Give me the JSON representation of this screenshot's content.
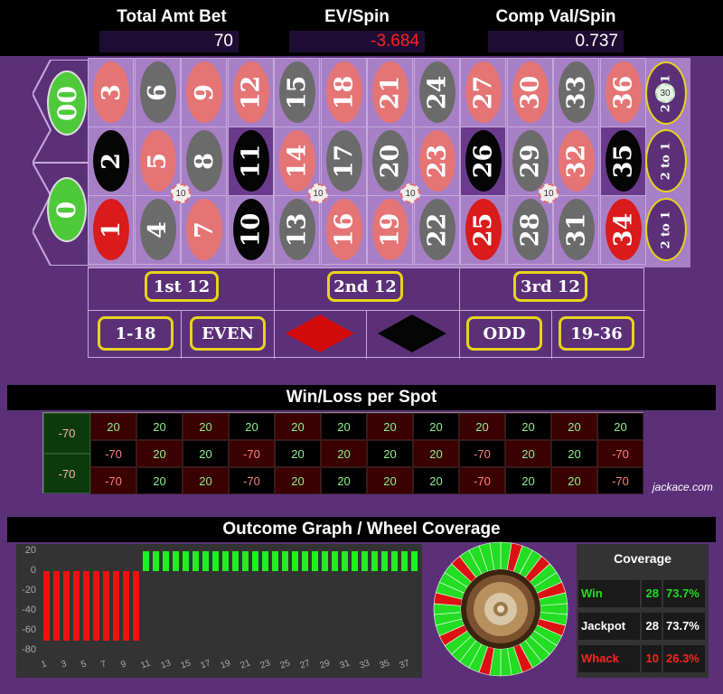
{
  "stats": {
    "total_label": "Total Amt Bet",
    "total_value": "70",
    "ev_label": "EV/Spin",
    "ev_value": "-3.684",
    "comp_label": "Comp Val/Spin",
    "comp_value": "0.737"
  },
  "board": {
    "double_zero": "00",
    "zero": "0",
    "rows": [
      [
        {
          "n": "3",
          "c": "pink"
        },
        {
          "n": "6",
          "c": "gray"
        },
        {
          "n": "9",
          "c": "pink"
        },
        {
          "n": "12",
          "c": "pink"
        },
        {
          "n": "15",
          "c": "gray"
        },
        {
          "n": "18",
          "c": "pink"
        },
        {
          "n": "21",
          "c": "pink"
        },
        {
          "n": "24",
          "c": "gray"
        },
        {
          "n": "27",
          "c": "pink"
        },
        {
          "n": "30",
          "c": "pink"
        },
        {
          "n": "33",
          "c": "gray"
        },
        {
          "n": "36",
          "c": "pink"
        }
      ],
      [
        {
          "n": "2",
          "c": "black"
        },
        {
          "n": "5",
          "c": "pink"
        },
        {
          "n": "8",
          "c": "gray"
        },
        {
          "n": "11",
          "c": "black"
        },
        {
          "n": "14",
          "c": "pink"
        },
        {
          "n": "17",
          "c": "gray"
        },
        {
          "n": "20",
          "c": "gray"
        },
        {
          "n": "23",
          "c": "pink"
        },
        {
          "n": "26",
          "c": "black"
        },
        {
          "n": "29",
          "c": "gray"
        },
        {
          "n": "32",
          "c": "pink"
        },
        {
          "n": "35",
          "c": "black"
        }
      ],
      [
        {
          "n": "1",
          "c": "red"
        },
        {
          "n": "4",
          "c": "gray"
        },
        {
          "n": "7",
          "c": "pink"
        },
        {
          "n": "10",
          "c": "black"
        },
        {
          "n": "13",
          "c": "gray"
        },
        {
          "n": "16",
          "c": "pink"
        },
        {
          "n": "19",
          "c": "pink"
        },
        {
          "n": "22",
          "c": "gray"
        },
        {
          "n": "25",
          "c": "red"
        },
        {
          "n": "28",
          "c": "gray"
        },
        {
          "n": "31",
          "c": "gray"
        },
        {
          "n": "34",
          "c": "red"
        }
      ]
    ],
    "columns": [
      "2 to 1",
      "2 to 1",
      "2 to 1"
    ],
    "dozens": [
      "1st 12",
      "2nd 12",
      "3rd 12"
    ],
    "outside": [
      "1-18",
      "EVEN",
      "ODD",
      "19-36"
    ],
    "chips": [
      "30",
      "10",
      "10",
      "10",
      "10"
    ]
  },
  "winloss": {
    "title": "Win/Loss per Spot",
    "zero_values": [
      "-70",
      "-70"
    ],
    "rows": [
      [
        "20",
        "20",
        "20",
        "20",
        "20",
        "20",
        "20",
        "20",
        "20",
        "20",
        "20",
        "20"
      ],
      [
        "-70",
        "20",
        "20",
        "-70",
        "20",
        "20",
        "20",
        "20",
        "-70",
        "20",
        "20",
        "-70"
      ],
      [
        "-70",
        "20",
        "20",
        "-70",
        "20",
        "20",
        "20",
        "20",
        "-70",
        "20",
        "20",
        "-70"
      ]
    ],
    "credit": "jackace.com"
  },
  "outcome": {
    "title": "Outcome Graph / Wheel Coverage",
    "y_ticks": [
      "20",
      "0",
      "-20",
      "-40",
      "-60",
      "-80"
    ],
    "x_ticks": [
      "1",
      "3",
      "5",
      "7",
      "9",
      "11",
      "13",
      "15",
      "17",
      "19",
      "21",
      "23",
      "25",
      "27",
      "29",
      "31",
      "33",
      "35",
      "37"
    ]
  },
  "chart_data": {
    "type": "bar",
    "title": "",
    "x": [
      1,
      2,
      3,
      4,
      5,
      6,
      7,
      8,
      9,
      10,
      11,
      12,
      13,
      14,
      15,
      16,
      17,
      18,
      19,
      20,
      21,
      22,
      23,
      24,
      25,
      26,
      27,
      28,
      29,
      30,
      31,
      32,
      33,
      34,
      35,
      36,
      37,
      38
    ],
    "values": [
      -70,
      -70,
      -70,
      -70,
      -70,
      -70,
      -70,
      -70,
      -70,
      -70,
      20,
      20,
      20,
      20,
      20,
      20,
      20,
      20,
      20,
      20,
      20,
      20,
      20,
      20,
      20,
      20,
      20,
      20,
      20,
      20,
      20,
      20,
      20,
      20,
      20,
      20,
      20,
      20
    ],
    "ylim": [
      -80,
      20
    ],
    "colors": {
      "win": "#22ee22",
      "loss": "#ee1111"
    }
  },
  "wheel": {
    "segments": [
      "W",
      "L",
      "W",
      "W",
      "L",
      "W",
      "W",
      "L",
      "W",
      "W",
      "W",
      "L",
      "W",
      "W",
      "W",
      "W",
      "L",
      "W",
      "W",
      "W",
      "L",
      "W",
      "W",
      "W",
      "W",
      "L",
      "W",
      "W",
      "W",
      "L",
      "W",
      "W",
      "W",
      "L",
      "W",
      "W",
      "W",
      "W"
    ],
    "colors": {
      "W": "#22dd22",
      "L": "#dd1111"
    }
  },
  "coverage": {
    "title": "Coverage",
    "rows": [
      {
        "label": "Win",
        "count": "28",
        "pct": "73.7%",
        "color": "#22dd22"
      },
      {
        "label": "Jackpot",
        "count": "28",
        "pct": "73.7%",
        "color": "#ffffff"
      },
      {
        "label": "Whack",
        "count": "10",
        "pct": "26.3%",
        "color": "#ff2222"
      }
    ]
  }
}
